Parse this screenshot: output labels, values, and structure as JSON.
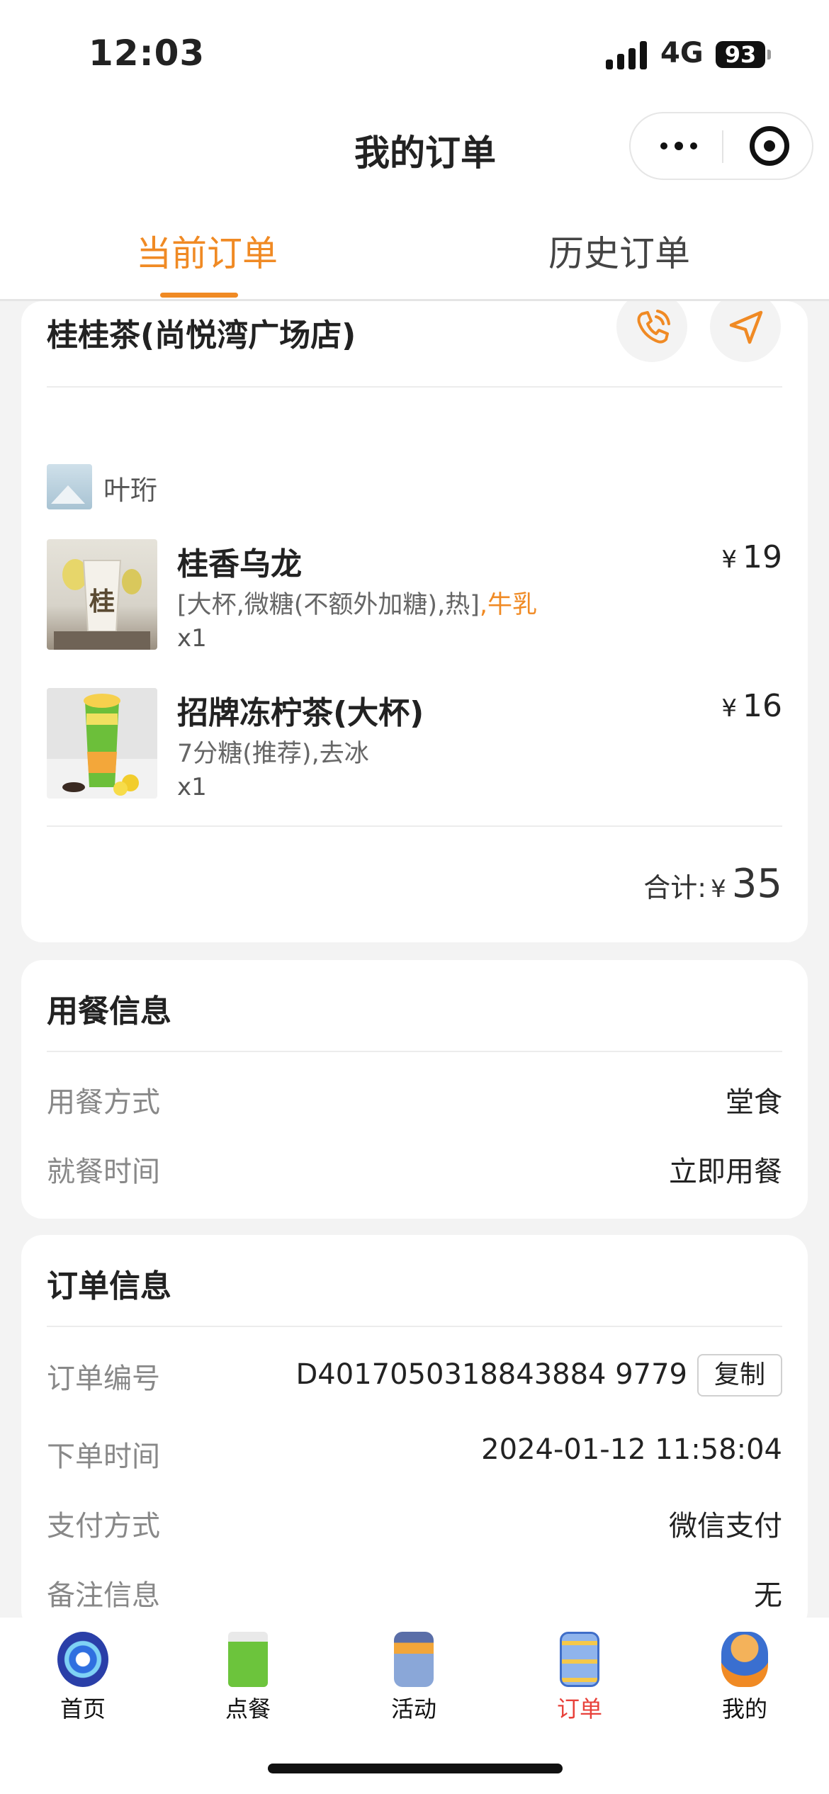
{
  "status_bar": {
    "time": "12:03",
    "network": "4G",
    "battery": "93"
  },
  "nav": {
    "title": "我的订单"
  },
  "tabs": [
    {
      "label": "当前订单",
      "active": true
    },
    {
      "label": "历史订单",
      "active": false
    }
  ],
  "order": {
    "store_name": "桂桂茶(尚悦湾广场店)",
    "user_name": "叶珩",
    "items": [
      {
        "name": "桂香乌龙",
        "spec": "[大杯,微糖(不额外加糖),热]",
        "spec_highlight": ",牛乳",
        "qty": "x1",
        "currency": "¥",
        "price": "19"
      },
      {
        "name": "招牌冻柠茶(大杯)",
        "spec": "7分糖(推荐),去冰",
        "spec_highlight": "",
        "qty": "x1",
        "currency": "¥",
        "price": "16"
      }
    ],
    "total_label": "合计:",
    "total_currency": "¥",
    "total_value": "35"
  },
  "dining": {
    "title": "用餐信息",
    "rows": [
      {
        "label": "用餐方式",
        "value": "堂食"
      },
      {
        "label": "就餐时间",
        "value": "立即用餐"
      }
    ]
  },
  "order_info": {
    "title": "订单信息",
    "order_no_label": "订单编号",
    "order_no": "D4017050318843884 9779",
    "copy_label": "复制",
    "rows": [
      {
        "label": "下单时间",
        "value": "2024-01-12 11:58:04"
      },
      {
        "label": "支付方式",
        "value": "微信支付"
      },
      {
        "label": "备注信息",
        "value": "无"
      }
    ]
  },
  "bottom_nav": [
    {
      "label": "首页",
      "icon": "home-icon",
      "active": false
    },
    {
      "label": "点餐",
      "icon": "order-food-icon",
      "active": false
    },
    {
      "label": "活动",
      "icon": "activity-icon",
      "active": false
    },
    {
      "label": "订单",
      "icon": "orders-icon",
      "active": true
    },
    {
      "label": "我的",
      "icon": "profile-icon",
      "active": false
    }
  ],
  "colors": {
    "accent": "#f08a24",
    "active_nav": "#e8413a",
    "background": "#f3f3f3"
  }
}
